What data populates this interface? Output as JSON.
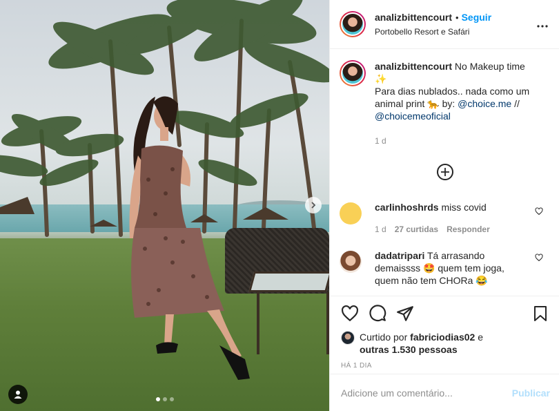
{
  "post": {
    "username": "analizbittencourt",
    "follow_label": "Seguir",
    "dot": "•",
    "location": "Portobello Resort e Safári",
    "more_icon": "more-horizontal-icon",
    "image_dots": 3,
    "active_dot": 0
  },
  "caption": {
    "username": "analizbittencourt",
    "text_1": " No Makeup time ",
    "emoji_1": "✨",
    "text_2": "Para dias nublados.. nada como um animal print ",
    "emoji_2": "🐆",
    "text_3": " by: ",
    "mention_1": "@choice.me",
    "text_4": " // ",
    "mention_2": "@choiceme​oficial",
    "time": "1 d"
  },
  "comments": [
    {
      "username": "carlinhoshrds",
      "text": " miss covid",
      "time": "1 d",
      "likes": "27 curtidas",
      "reply": "Responder",
      "avatar_color": "#f9d056"
    },
    {
      "username": "dadatripari",
      "text": " Tá arrasando demaissss ",
      "emoji_1": "🤩",
      "text_2": " quem tem joga, quem não tem CHORa ",
      "emoji_2": "😂"
    }
  ],
  "actions": {
    "like_icon": "heart-icon",
    "comment_icon": "comment-icon",
    "share_icon": "send-icon",
    "save_icon": "bookmark-icon"
  },
  "likes": {
    "prefix": "Curtido por ",
    "liker": "fabriciodias02",
    "middle": " e",
    "others": "outras 1.530 pessoas"
  },
  "time_ago": "HÁ 1 DIA",
  "add_comment": {
    "placeholder": "Adicione um comentário...",
    "publish_label": "Publicar"
  }
}
